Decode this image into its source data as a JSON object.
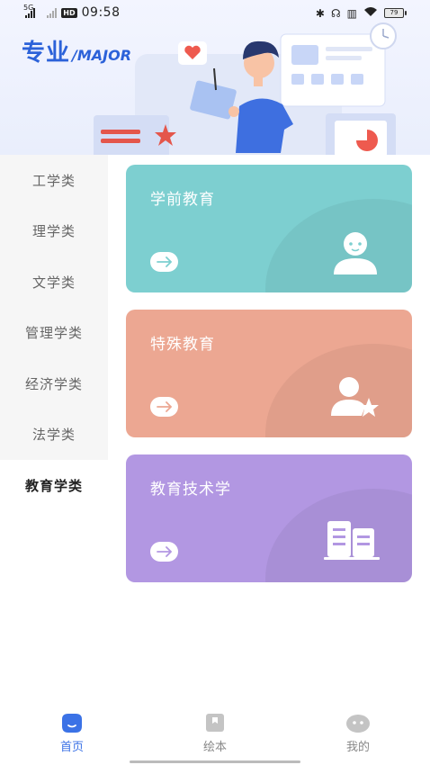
{
  "status_bar": {
    "network": "5G",
    "time": "09:58",
    "battery": "79"
  },
  "header": {
    "title_cn": "专业",
    "title_en": "/MAJOR"
  },
  "sidebar": {
    "items": [
      {
        "label": "工学类",
        "active": false
      },
      {
        "label": "理学类",
        "active": false
      },
      {
        "label": "文学类",
        "active": false
      },
      {
        "label": "管理学类",
        "active": false
      },
      {
        "label": "经济学类",
        "active": false
      },
      {
        "label": "法学类",
        "active": false
      },
      {
        "label": "教育学类",
        "active": true
      }
    ]
  },
  "cards": [
    {
      "title": "学前教育",
      "color": "#7dcfd0",
      "icon": "child-icon"
    },
    {
      "title": "特殊教育",
      "color": "#eca792",
      "icon": "person-star-icon"
    },
    {
      "title": "教育技术学",
      "color": "#b297e2",
      "icon": "building-icon"
    }
  ],
  "tab_bar": {
    "tabs": [
      {
        "label": "首页",
        "icon": "home-icon",
        "active": true
      },
      {
        "label": "绘本",
        "icon": "picture-book-icon",
        "active": false
      },
      {
        "label": "我的",
        "icon": "profile-icon",
        "active": false
      }
    ]
  },
  "colors": {
    "accent": "#2c62d9",
    "tab_active": "#3b72e6"
  }
}
